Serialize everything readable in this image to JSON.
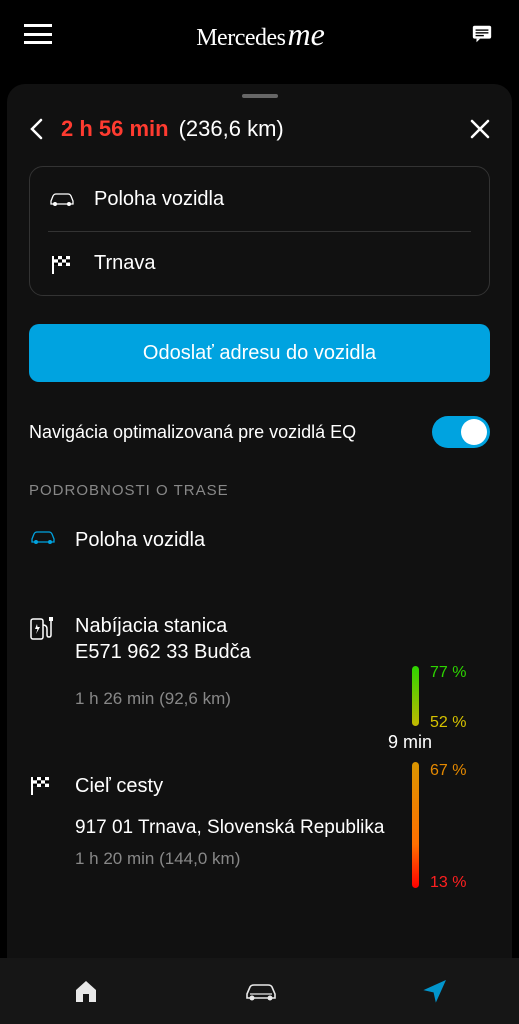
{
  "app": {
    "brand_a": "Mercedes",
    "brand_b": "me"
  },
  "trip": {
    "duration": "2 h 56 min",
    "distance": "(236,6 km)"
  },
  "route": {
    "from_label": "Poloha vozidla",
    "to_label": "Trnava"
  },
  "actions": {
    "send_to_vehicle": "Odoslať adresu do vozidla"
  },
  "toggle": {
    "label": "Navigácia optimalizovaná pre vozidlá EQ",
    "on": true
  },
  "section": {
    "details_title": "PODROBNOSTI O TRASE"
  },
  "details": {
    "start": {
      "title": "Poloha vozidla"
    },
    "charge": {
      "title": "Nabíjacia stanica",
      "subtitle": "E571 962 33 Budča",
      "leg": "1 h 26 min (92,6 km)",
      "wait": "9 min"
    },
    "dest": {
      "title": "Cieľ cesty",
      "address": "917 01 Trnava, Slovenská Republika",
      "leg": "1 h 20 min (144,0 km)"
    }
  },
  "battery": {
    "start_pct": "77 %",
    "arrive_charge_pct": "52 %",
    "after_charge_pct": "67 %",
    "arrive_dest_pct": "13 %"
  }
}
